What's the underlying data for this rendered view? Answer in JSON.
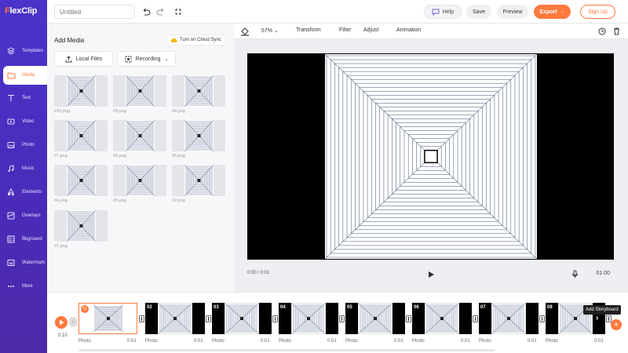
{
  "brand": {
    "name_prefix": "F",
    "name_rest": "lexClip",
    "accent": "#ff7a3d",
    "nav_color": "#4b33c9"
  },
  "topbar": {
    "title_placeholder": "Untitled",
    "help_label": "Help",
    "save_label": "Save",
    "preview_label": "Preview",
    "export_label": "Export",
    "signup_label": "Sign Up"
  },
  "sidebar": {
    "items": [
      {
        "label": "Templates",
        "icon": "layers-icon"
      },
      {
        "label": "Media",
        "icon": "folder-icon"
      },
      {
        "label": "Text",
        "icon": "text-icon"
      },
      {
        "label": "Video",
        "icon": "video-icon"
      },
      {
        "label": "Photo",
        "icon": "photo-icon"
      },
      {
        "label": "Music",
        "icon": "music-icon"
      },
      {
        "label": "Elements",
        "icon": "elements-icon"
      },
      {
        "label": "Overlays",
        "icon": "overlays-icon"
      },
      {
        "label": "Bkground",
        "icon": "background-icon"
      },
      {
        "label": "Watermark",
        "icon": "watermark-icon"
      },
      {
        "label": "More",
        "icon": "more-icon"
      }
    ],
    "active": "Media"
  },
  "media_panel": {
    "title": "Add Media",
    "cloud_sync_label": "Turn on Cloud Sync",
    "local_files_label": "Local Files",
    "recording_label": "Recording",
    "files": [
      "#10.png",
      "#9.png",
      "#8.png",
      "#7.png",
      "#6.png",
      "#5.png",
      "#4.png",
      "#3.png",
      "#2.png",
      "#1.png"
    ]
  },
  "editor_toolbar": {
    "zoom": "57%",
    "transform_label": "Transform",
    "filter_label": "Filter",
    "adjust_label": "Adjust",
    "animation_label": "Animation"
  },
  "player": {
    "current_time": "0:00 / 0:01",
    "total_time": "01:00"
  },
  "timeline": {
    "time": "0:10",
    "scenes": [
      {
        "num": "01",
        "label": "Photo",
        "duration": "0:01"
      },
      {
        "num": "02",
        "label": "Photo",
        "duration": "0:01"
      },
      {
        "num": "03",
        "label": "Photo",
        "duration": "0:01"
      },
      {
        "num": "04",
        "label": "Photo",
        "duration": "0:01"
      },
      {
        "num": "05",
        "label": "Photo",
        "duration": "0:01"
      },
      {
        "num": "06",
        "label": "Photo",
        "duration": "0:01"
      },
      {
        "num": "07",
        "label": "Photo",
        "duration": "0:01"
      },
      {
        "num": "08",
        "label": "Photo",
        "duration": "0:01"
      }
    ],
    "add_storyboard_tooltip": "Add Storyboard"
  }
}
